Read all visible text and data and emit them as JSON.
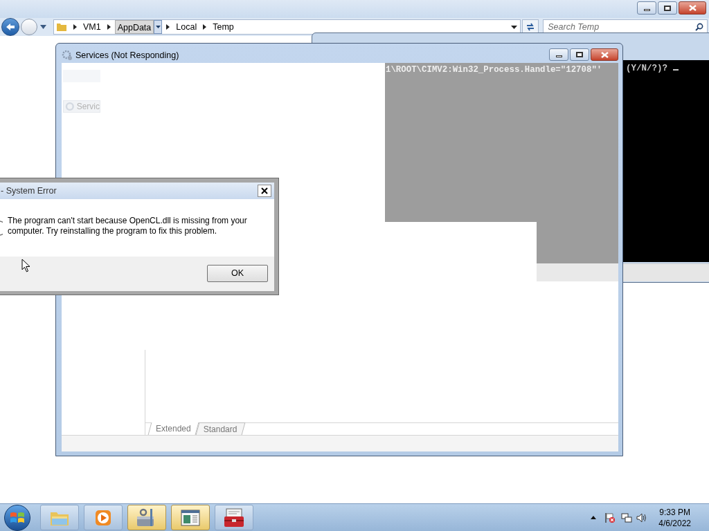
{
  "explorer": {
    "breadcrumb": [
      {
        "label": "VM1",
        "selected": false
      },
      {
        "label": "AppData",
        "selected": true
      },
      {
        "label": "Local",
        "selected": false
      },
      {
        "label": "Temp",
        "selected": false
      }
    ],
    "search": {
      "placeholder": "Search Temp"
    }
  },
  "console": {
    "prompt": "(Y/N/?)? "
  },
  "services": {
    "title": "Services (Not Responding)",
    "ghost_text": "1\\ROOT\\CIMV2:Win32_Process.Handle=\"12708\"'",
    "ghost_tree_item": "Servic",
    "tabs": [
      {
        "label": "Extended",
        "selected": true
      },
      {
        "label": "Standard",
        "selected": false
      }
    ]
  },
  "error_dialog": {
    "title": "- System Error",
    "message": "The program can't start because OpenCL.dll is missing from your computer. Try reinstalling the program to fix this problem.",
    "button": "OK"
  },
  "taskbar": {
    "buttons": [
      {
        "kind": "folder",
        "active": false
      },
      {
        "kind": "media",
        "active": false
      },
      {
        "kind": "tools",
        "active": true
      },
      {
        "kind": "window",
        "active": true
      },
      {
        "kind": "toolbox",
        "active": false
      }
    ],
    "time": "9:33 PM",
    "date": "4/6/2022"
  }
}
